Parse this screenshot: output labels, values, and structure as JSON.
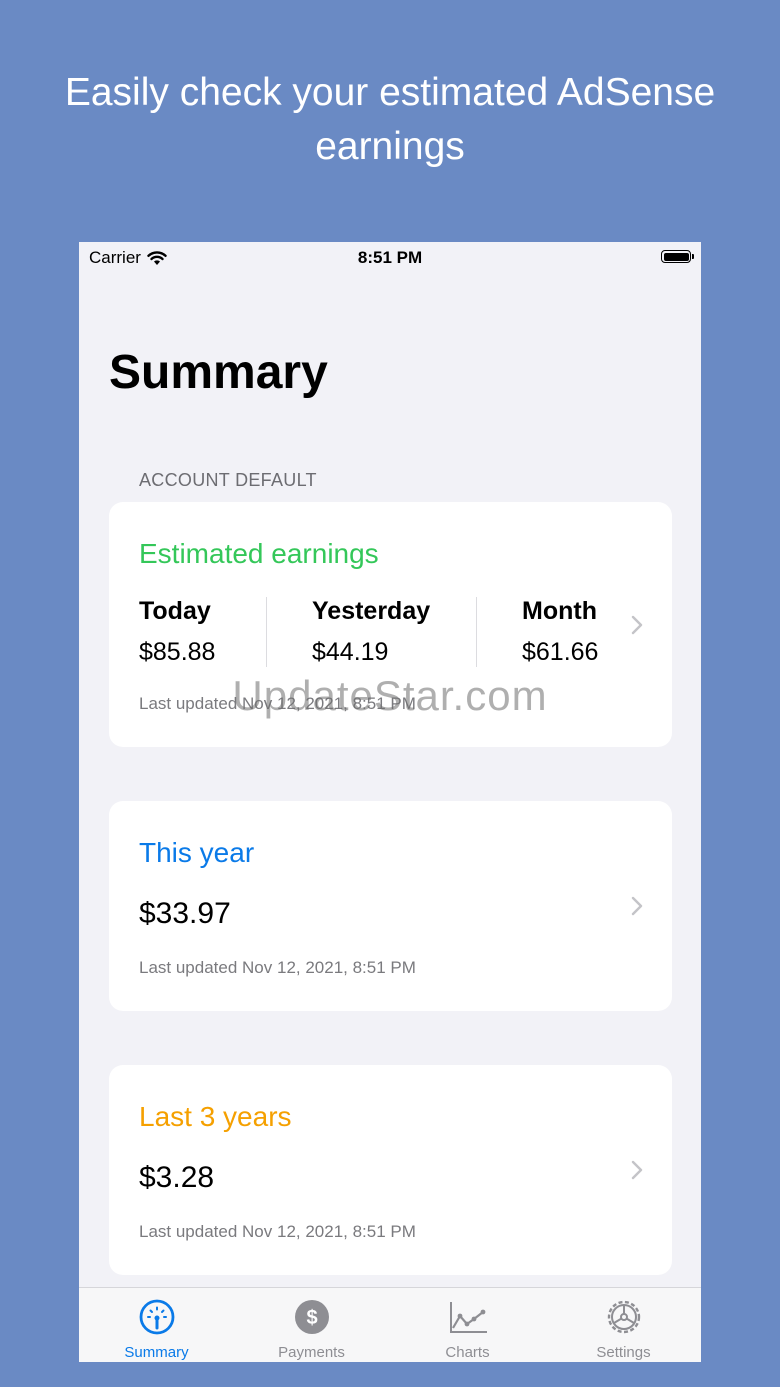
{
  "headline": "Easily check your estimated AdSense earnings",
  "status_bar": {
    "carrier": "Carrier",
    "time": "8:51 PM"
  },
  "page_title": "Summary",
  "section_header": "ACCOUNT DEFAULT",
  "estimated": {
    "title": "Estimated earnings",
    "title_color": "#34c759",
    "columns": [
      {
        "label": "Today",
        "value": "$85.88"
      },
      {
        "label": "Yesterday",
        "value": "$44.19"
      },
      {
        "label": "Month",
        "value": "$61.66"
      }
    ],
    "updated": "Last updated Nov 12, 2021, 8:51 PM"
  },
  "this_year": {
    "title": "This year",
    "title_color": "#0a7ae8",
    "value": "$33.97",
    "updated": "Last updated Nov 12, 2021, 8:51 PM"
  },
  "last_3_years": {
    "title": "Last 3 years",
    "title_color": "#f5a000",
    "value": "$3.28",
    "updated": "Last updated Nov 12, 2021, 8:51 PM"
  },
  "watermark": "UpdateStar.com",
  "tabs": [
    {
      "label": "Summary",
      "icon": "speedometer-icon",
      "active": true
    },
    {
      "label": "Payments",
      "icon": "dollar-circle-icon",
      "active": false
    },
    {
      "label": "Charts",
      "icon": "line-chart-icon",
      "active": false
    },
    {
      "label": "Settings",
      "icon": "gear-icon",
      "active": false
    }
  ],
  "colors": {
    "background": "#6a8ac4",
    "active_tab": "#0a7ae8",
    "inactive_tab": "#8e8e93"
  }
}
